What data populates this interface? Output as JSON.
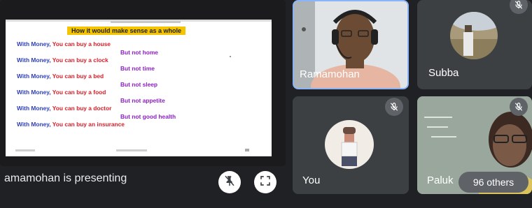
{
  "presentation": {
    "slide_title": "How it would make sense as a whole",
    "lines": [
      {
        "a": "With Money,",
        "b": " You can buy a house"
      },
      {
        "r": "But not home"
      },
      {
        "a": "With Money,",
        "b": " You can buy a clock"
      },
      {
        "r": "But not time"
      },
      {
        "a": "With Money,",
        "b": " You can buy a bed"
      },
      {
        "r": "But not sleep"
      },
      {
        "a": "With Money,",
        "b": " You can buy a food"
      },
      {
        "r": "But not appetite"
      },
      {
        "a": "With Money,",
        "b": " You can buy a doctor"
      },
      {
        "r": "But not good health"
      },
      {
        "a": "With Money,",
        "b": " You can buy an insurance"
      }
    ],
    "presenting_label": "amamohan is presenting",
    "unpin_icon": "pin-off-icon",
    "fullscreen_icon": "fullscreen-icon"
  },
  "participants": [
    {
      "name": "Ramamohan",
      "active": true
    },
    {
      "name": "Subba",
      "muted": true
    },
    {
      "name": "You",
      "muted": true
    },
    {
      "name": "Paluk"
    }
  ],
  "others_count": "96 others",
  "colors": {
    "background": "#202124",
    "tile": "#3c4043",
    "active_border": "#8ab4f8",
    "slide_blue": "#2e3fbf",
    "slide_red": "#d8202a",
    "slide_purple": "#8b1fc2",
    "title_highlight": "#f5c400"
  }
}
